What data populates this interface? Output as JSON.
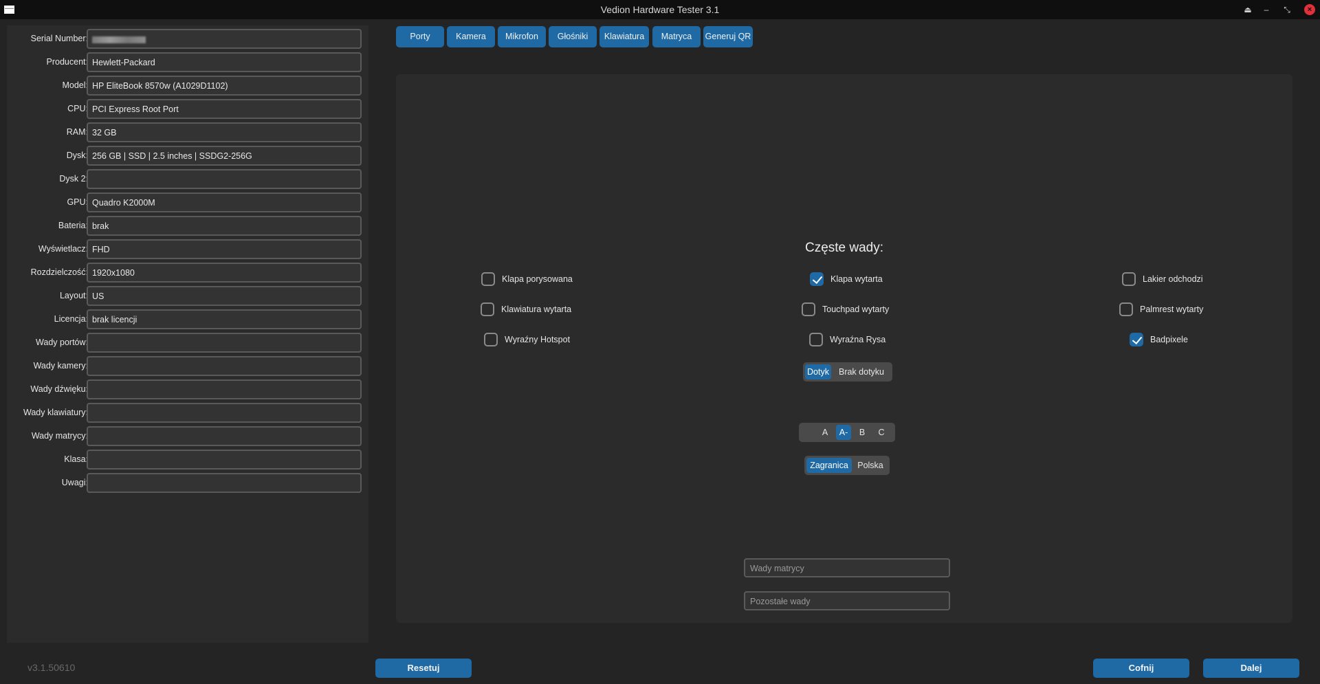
{
  "window": {
    "title": "Vedion Hardware Tester 3.1"
  },
  "fields": [
    {
      "label": "Serial Number:",
      "value": ""
    },
    {
      "label": "Producent:",
      "value": "Hewlett-Packard"
    },
    {
      "label": "Model:",
      "value": "HP EliteBook 8570w (A1029D1102)"
    },
    {
      "label": "CPU:",
      "value": "PCI Express Root Port"
    },
    {
      "label": "RAM:",
      "value": "32 GB"
    },
    {
      "label": "Dysk:",
      "value": "256 GB | SSD | 2.5 inches | SSDG2-256G"
    },
    {
      "label": "Dysk 2:",
      "value": ""
    },
    {
      "label": "GPU:",
      "value": "Quadro K2000M"
    },
    {
      "label": "Bateria:",
      "value": "brak"
    },
    {
      "label": "Wyświetlacz:",
      "value": "FHD"
    },
    {
      "label": "Rozdzielczość:",
      "value": "1920x1080"
    },
    {
      "label": "Layout:",
      "value": "US"
    },
    {
      "label": "Licencja:",
      "value": "brak licencji"
    },
    {
      "label": "Wady portów:",
      "value": ""
    },
    {
      "label": "Wady kamery:",
      "value": ""
    },
    {
      "label": "Wady dźwięku:",
      "value": ""
    },
    {
      "label": "Wady klawiatury:",
      "value": ""
    },
    {
      "label": "Wady matrycy:",
      "value": ""
    },
    {
      "label": "Klasa:",
      "value": ""
    },
    {
      "label": "Uwagi:",
      "value": ""
    }
  ],
  "version": "v3.1.50610",
  "tabs": [
    "Porty",
    "Kamera",
    "Mikrofon",
    "Głośniki",
    "Klawiatura",
    "Matryca",
    "Generuj QR"
  ],
  "defects": {
    "title": "Częste wady:",
    "items": [
      {
        "label": "Klapa porysowana",
        "checked": false
      },
      {
        "label": "Klapa wytarta",
        "checked": true
      },
      {
        "label": "Lakier odchodzi",
        "checked": false
      },
      {
        "label": "Klawiatura wytarta",
        "checked": false
      },
      {
        "label": "Touchpad wytarty",
        "checked": false
      },
      {
        "label": "Palmrest wytarty",
        "checked": false
      },
      {
        "label": "Wyraźny Hotspot",
        "checked": false
      },
      {
        "label": "Wyraźna Rysa",
        "checked": false
      },
      {
        "label": "Badpixele",
        "checked": true
      }
    ]
  },
  "touch": {
    "options": [
      "Dotyk",
      "Brak dotyku"
    ],
    "selected": "Dotyk"
  },
  "grade": {
    "options": [
      "A",
      "A-",
      "B",
      "C"
    ],
    "selected": "A-"
  },
  "origin": {
    "options": [
      "Zagranica",
      "Polska"
    ],
    "selected": "Zagranica"
  },
  "inputs": {
    "matrix_placeholder": "Wady matrycy",
    "other_placeholder": "Pozostałe wady"
  },
  "buttons": {
    "reset": "Resetuj",
    "back": "Cofnij",
    "next": "Dalej"
  }
}
